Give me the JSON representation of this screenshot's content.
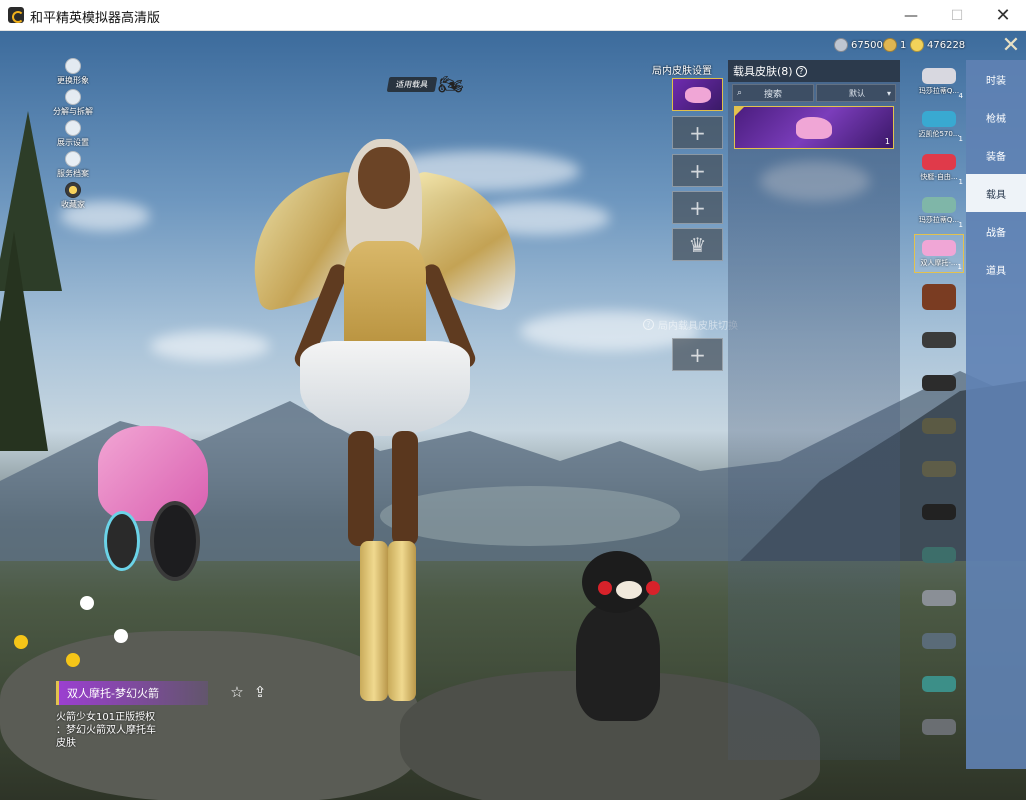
{
  "window": {
    "title": "和平精英模拟器高清版",
    "minimize": "—",
    "maximize": "☐",
    "close": "✕"
  },
  "left_menu": [
    {
      "label": "更换形象",
      "icon": "person-icon"
    },
    {
      "label": "分解与拆解",
      "icon": "puzzle-icon"
    },
    {
      "label": "展示设置",
      "icon": "eye-icon"
    },
    {
      "label": "服务档案",
      "icon": "profile-icon"
    },
    {
      "label": "收藏家",
      "icon": "collector-badge-icon"
    }
  ],
  "vehicle_tag": "适用载具",
  "currency": [
    {
      "value": "67500",
      "color": "#bfc6d1"
    },
    {
      "value": "1",
      "color": "#e0b652"
    },
    {
      "value": "476228",
      "color": "#f2d25a"
    }
  ],
  "exit_icon": "✕",
  "slots": {
    "title": "局内皮肤设置",
    "note": "局内载具皮肤切换",
    "add_symbol": "+",
    "crown_symbol": "♛"
  },
  "skin_panel": {
    "title": "载具皮肤",
    "count": "(8)",
    "help": "?",
    "search_label": "搜索",
    "sort_label": "默认",
    "card_count": "1"
  },
  "vehicles": [
    {
      "label": "玛莎拉蒂Q...",
      "count": "4",
      "color": "#d8d8e0"
    },
    {
      "label": "迈凯伦570...",
      "count": "1",
      "color": "#39a9d1"
    },
    {
      "label": "快艇-自由...",
      "count": "1",
      "color": "#e03a4a"
    },
    {
      "label": "玛莎拉蒂Q...",
      "count": "1",
      "color": "#7fb6a8"
    },
    {
      "label": "双人摩托-...",
      "count": "1",
      "color": "#f0a6d6"
    },
    {
      "label": "",
      "count": "",
      "color": "#7a3c22"
    },
    {
      "label": "",
      "count": "",
      "color": "#3b3b3b"
    },
    {
      "label": "",
      "count": "",
      "color": "#2c2c2c"
    },
    {
      "label": "",
      "count": "",
      "color": "#5b5a44"
    },
    {
      "label": "",
      "count": "",
      "color": "#5e5d48"
    },
    {
      "label": "",
      "count": "",
      "color": "#222222"
    },
    {
      "label": "",
      "count": "",
      "color": "#3d6e6a"
    },
    {
      "label": "",
      "count": "",
      "color": "#8a8f96"
    },
    {
      "label": "",
      "count": "",
      "color": "#5a6b78"
    },
    {
      "label": "",
      "count": "",
      "color": "#3c8f88"
    },
    {
      "label": "",
      "count": "",
      "color": "#6a6e72"
    }
  ],
  "categories": [
    {
      "label": "时装",
      "active": false
    },
    {
      "label": "枪械",
      "active": false
    },
    {
      "label": "装备",
      "active": false
    },
    {
      "label": "载具",
      "active": true
    },
    {
      "label": "战备",
      "active": false
    },
    {
      "label": "道具",
      "active": false
    }
  ],
  "item": {
    "name": "双人摩托-梦幻火箭",
    "desc_line1": "火箭少女101正版授权",
    "desc_line2": "：梦幻火箭双人摩托车",
    "desc_line3": "皮肤",
    "fav_icon": "☆",
    "share_icon": "⇪"
  },
  "colors": {
    "accent_gold": "#e3c24e",
    "accent_purple": "#9b3fd0",
    "tab_active_bg": "#eef3f8"
  }
}
